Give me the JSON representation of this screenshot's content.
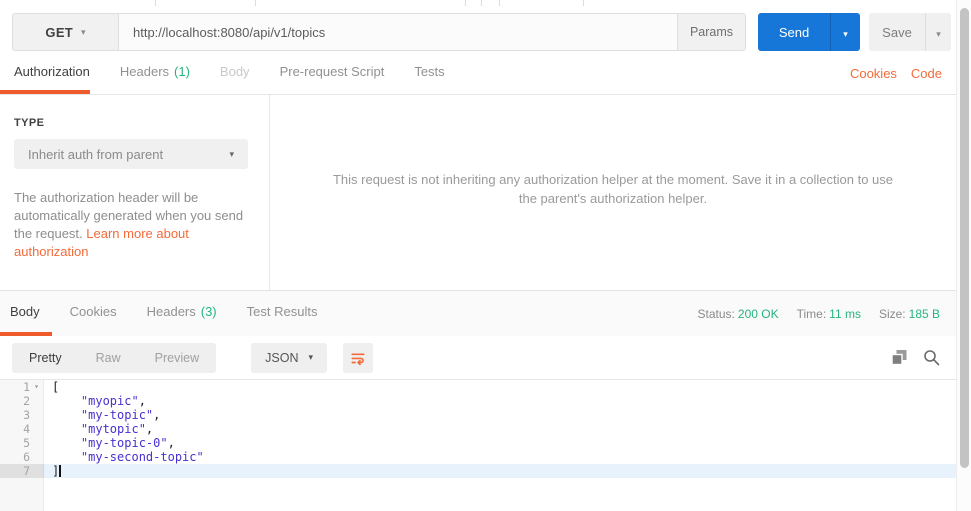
{
  "request": {
    "method": "GET",
    "url": "http://localhost:8080/api/v1/topics",
    "params_label": "Params",
    "send_label": "Send",
    "save_label": "Save"
  },
  "request_tabs": {
    "items": [
      {
        "label": "Authorization"
      },
      {
        "label": "Headers",
        "count": "(1)"
      },
      {
        "label": "Body"
      },
      {
        "label": "Pre-request Script"
      },
      {
        "label": "Tests"
      }
    ],
    "cookies_link": "Cookies",
    "code_link": "Code"
  },
  "authorization": {
    "type_label": "TYPE",
    "type_value": "Inherit auth from parent",
    "description": "The authorization header will be automatically generated when you send the request. ",
    "link_text": "Learn more about authorization",
    "helper_message": "This request is not inheriting any authorization helper at the moment. Save it in a collection to use the parent's authorization helper."
  },
  "response": {
    "tabs": [
      {
        "label": "Body"
      },
      {
        "label": "Cookies"
      },
      {
        "label": "Headers",
        "count": "(3)"
      },
      {
        "label": "Test Results"
      }
    ],
    "status_label": "Status:",
    "status_value": "200 OK",
    "time_label": "Time:",
    "time_value": "11 ms",
    "size_label": "Size:",
    "size_value": "185 B",
    "view_modes": [
      "Pretty",
      "Raw",
      "Preview"
    ],
    "format_value": "JSON"
  },
  "editor": {
    "lines": [
      {
        "num": "1",
        "code": "["
      },
      {
        "num": "2",
        "str": "    \"myopic\"",
        "punct": ","
      },
      {
        "num": "3",
        "str": "    \"my-topic\"",
        "punct": ","
      },
      {
        "num": "4",
        "str": "    \"mytopic\"",
        "punct": ","
      },
      {
        "num": "5",
        "str": "    \"my-topic-0\"",
        "punct": ","
      },
      {
        "num": "6",
        "str": "    \"my-second-topic\"",
        "punct": ""
      },
      {
        "num": "7",
        "code": "]"
      }
    ]
  },
  "icons": {
    "caret_down": "▾"
  },
  "colors": {
    "accent_orange": "#f26b3a",
    "underline_orange": "#f05b2d",
    "success_green": "#26b47e",
    "send_blue": "#1777d9",
    "string_token": "#4631cf"
  }
}
